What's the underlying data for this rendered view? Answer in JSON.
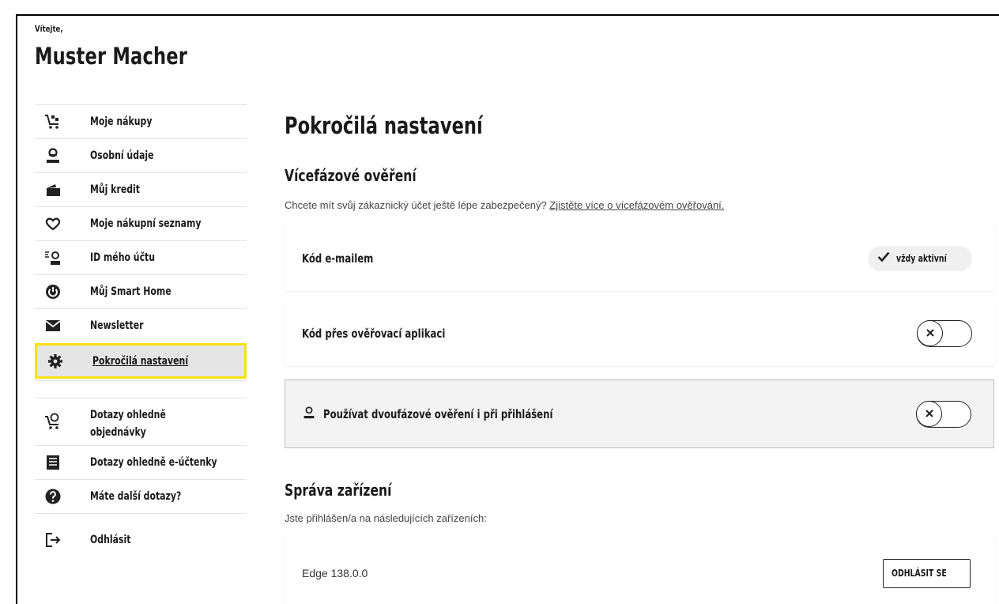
{
  "greeting": {
    "small": "Vítejte,",
    "name": "Muster Macher"
  },
  "sidebar": {
    "items": [
      {
        "label": "Moje nákupy",
        "icon": "shopping-cart-icon"
      },
      {
        "label": "Osobní údaje",
        "icon": "user-icon"
      },
      {
        "label": "Můj kredit",
        "icon": "wallet-icon"
      },
      {
        "label": "Moje nákupní seznamy",
        "icon": "heart-icon"
      },
      {
        "label": "ID mého účtu",
        "icon": "id-card-icon"
      },
      {
        "label": "Můj Smart Home",
        "icon": "power-icon"
      },
      {
        "label": "Newsletter",
        "icon": "envelope-icon"
      },
      {
        "label": "Pokročilá nastavení",
        "icon": "gear-icon"
      }
    ],
    "help_items": [
      {
        "label": "Dotazy ohledně objednávky",
        "icon": "cart-question-icon"
      },
      {
        "label": "Dotazy ohledně e-účtenky",
        "icon": "receipt-icon"
      },
      {
        "label": "Máte další dotazy?",
        "icon": "question-icon"
      }
    ],
    "logout": {
      "label": "Odhlásit",
      "icon": "logout-icon"
    }
  },
  "main": {
    "title": "Pokročilá nastavení",
    "mfa": {
      "heading": "Vícefázové ověření",
      "description": "Chcete mít svůj zákaznický účet ještě lépe zabezpečený?",
      "link": "Zjistěte více o vícefázovém ověřování.",
      "email_code": {
        "label": "Kód e-mailem",
        "badge": "vždy aktivní"
      },
      "app_code": {
        "label": "Kód přes ověřovací aplikaci",
        "enabled": false
      },
      "two_factor_login": {
        "label": "Používat dvoufázové ověření i při přihlášení",
        "enabled": false
      }
    },
    "devices": {
      "heading": "Správa zařízení",
      "description": "Jste přihlášen/a na následujících zařízeních:",
      "items": [
        {
          "name": "Edge 138.0.0",
          "button": "ODHLÁSIT SE"
        }
      ]
    }
  },
  "colors": {
    "highlight": "#f5e20f",
    "active_bg": "#e5e5e5"
  }
}
